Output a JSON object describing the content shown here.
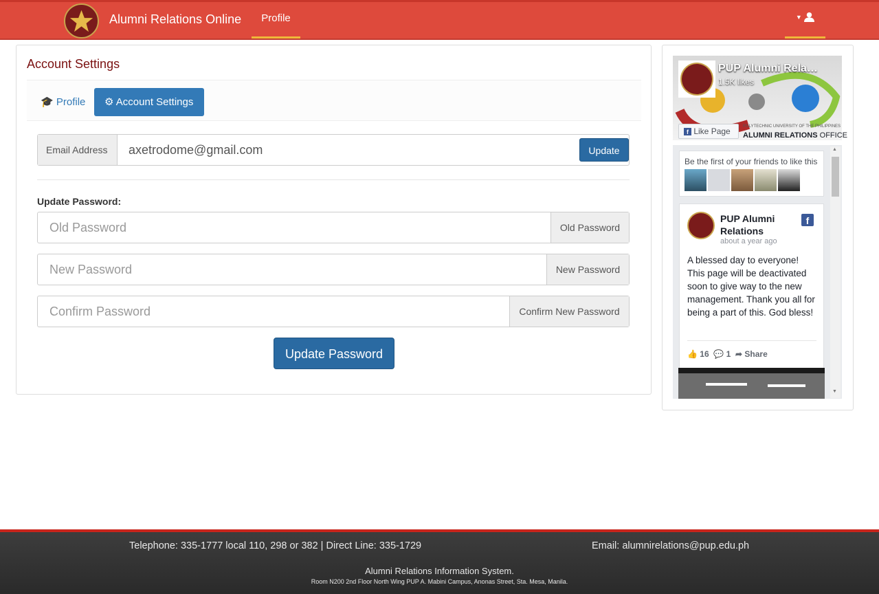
{
  "navbar": {
    "brand": "Alumni Relations Online",
    "profile_tab": "Profile",
    "user_icon": "user-icon"
  },
  "panel": {
    "title": "Account Settings",
    "tabs": [
      {
        "label": "Profile",
        "icon": "graduation-cap-icon"
      },
      {
        "label": "Account Settings",
        "icon": "gear-icon"
      }
    ],
    "email": {
      "label": "Email Address",
      "value": "axetrodome@gmail.com",
      "button": "Update"
    },
    "password": {
      "heading": "Update Password:",
      "old": {
        "placeholder": "Old Password",
        "addon": "Old Password"
      },
      "new": {
        "placeholder": "New Password",
        "addon": "New Password"
      },
      "confirm": {
        "placeholder": "Confirm Password",
        "addon": "Confirm New Password"
      },
      "button": "Update Password"
    }
  },
  "facebook": {
    "page_name": "PUP Alumni Relations",
    "likes": "1.5K likes",
    "like_button": "Like Page",
    "cover_caption_small": "POLYTECHNIC UNIVERSITY OF THE PHILIPPINES",
    "cover_caption_bold": "ALUMNI RELATIONS",
    "cover_caption_light": "OFFICE",
    "friends_text": "Be the first of your friends to like this",
    "post": {
      "author": "PUP Alumni Relations",
      "time": "about a year ago",
      "text": "A blessed day to everyone! This page will be deactivated soon to give way to the new management. Thank you all for being a part of this. God bless!",
      "likes": "16",
      "comments": "1",
      "share": "Share"
    }
  },
  "footer": {
    "telephone": "Telephone: 335-1777 local 110, 298 or 382 | Direct Line: 335-1729",
    "email": "Email: alumnirelations@pup.edu.ph",
    "system": "Alumni Relations Information System.",
    "address": "Room N200 2nd Floor North Wing PUP A. Mabini Campus, Anonas Street, Sta. Mesa, Manila."
  },
  "colors": {
    "navbar": "#de4a3c",
    "accent": "#f0b83a",
    "primary": "#337ab7",
    "title": "#7a1010",
    "footer": "#333333"
  }
}
